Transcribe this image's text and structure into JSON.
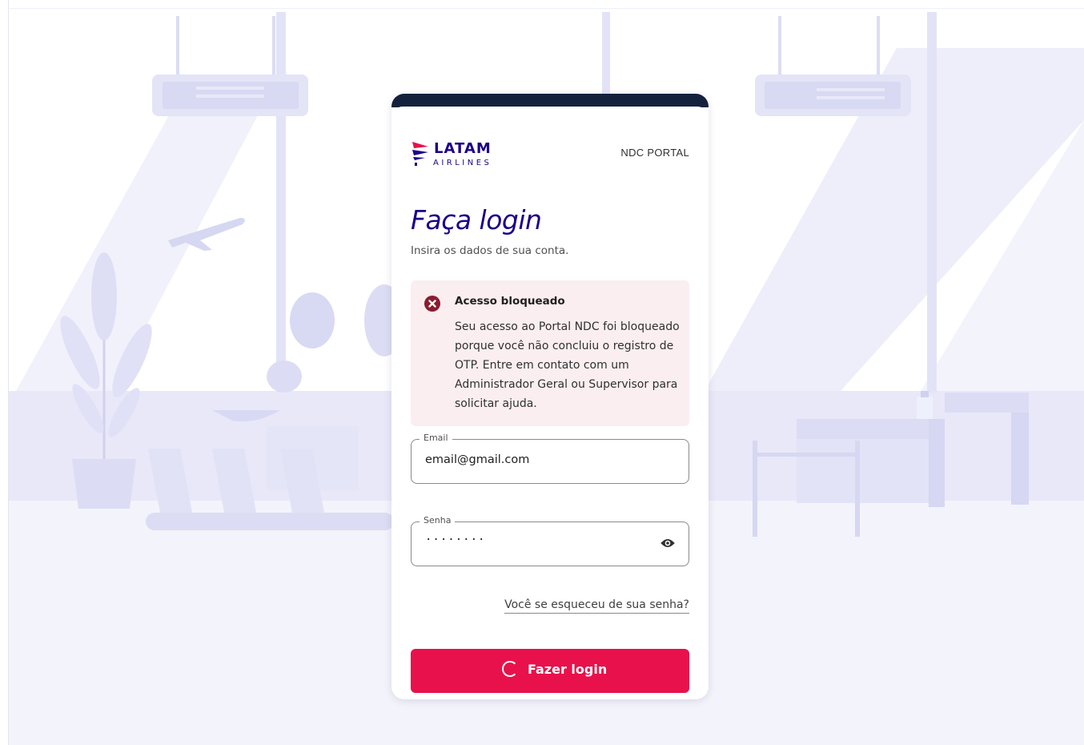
{
  "brand": {
    "logo_text": "LATAM",
    "logo_subtext": "AIRLINES",
    "portal_label": "NDC PORTAL",
    "primary_color": "#1b0088",
    "accent_color": "#e8114b"
  },
  "login": {
    "title": "Faça login",
    "subtitle": "Insira os dados de sua conta.",
    "alert": {
      "title": "Acesso bloqueado",
      "message": "Seu acesso ao Portal NDC foi bloqueado porque você não concluiu o registro de OTP. Entre em contato com um Administrador Geral ou Supervisor para solicitar ajuda.",
      "icon": "error-circle-icon",
      "color": "#8c1c2e"
    },
    "email": {
      "label": "Email",
      "value": "email@gmail.com"
    },
    "password": {
      "label": "Senha",
      "masked_value": "········",
      "toggle_icon": "eye-icon"
    },
    "forgot_link": "Você se esqueceu de sua senha?",
    "submit": {
      "label": "Fazer login",
      "icon": "loading-spinner-icon"
    }
  }
}
